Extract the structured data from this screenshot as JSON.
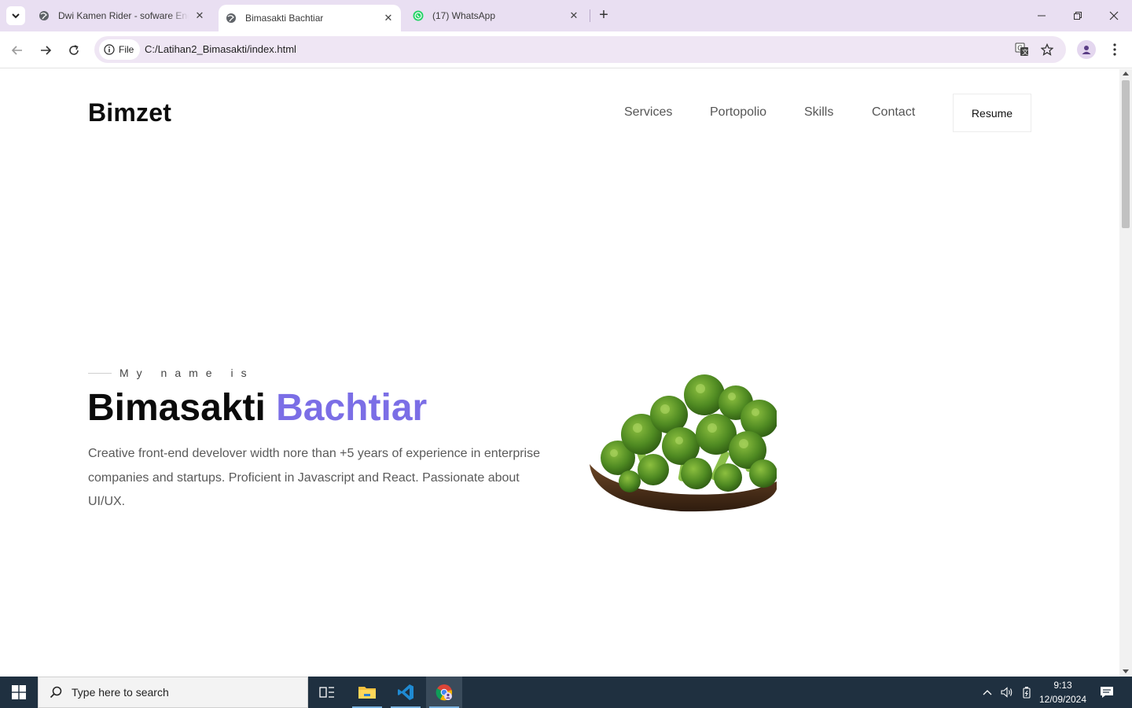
{
  "browser": {
    "tabs": [
      {
        "title": "Dwi Kamen Rider - sofware Eng",
        "active": false
      },
      {
        "title": "Bimasakti Bachtiar",
        "active": true
      },
      {
        "title": "(17) WhatsApp",
        "active": false
      }
    ],
    "address": {
      "chip_label": "File",
      "url": "C:/Latihan2_Bimasakti/index.html"
    }
  },
  "page": {
    "logo": "Bimzet",
    "nav": [
      "Services",
      "Portopolio",
      "Skills",
      "Contact"
    ],
    "resume_label": "Resume",
    "hero": {
      "eyebrow": "My name is",
      "first_name": "Bimasakti",
      "last_name": "Bachtiar",
      "description": "Creative front-end develover width nore than +5 years of experience in enterprise companies and startups. Proficient in Javascript and React. Passionate about UI/UX."
    },
    "colors": {
      "accent": "#7b6ee6",
      "tabstrip": "#e9dff2",
      "taskbar": "#1f3040"
    }
  },
  "taskbar": {
    "search_placeholder": "Type here to search",
    "time": "9:13",
    "date": "12/09/2024"
  }
}
